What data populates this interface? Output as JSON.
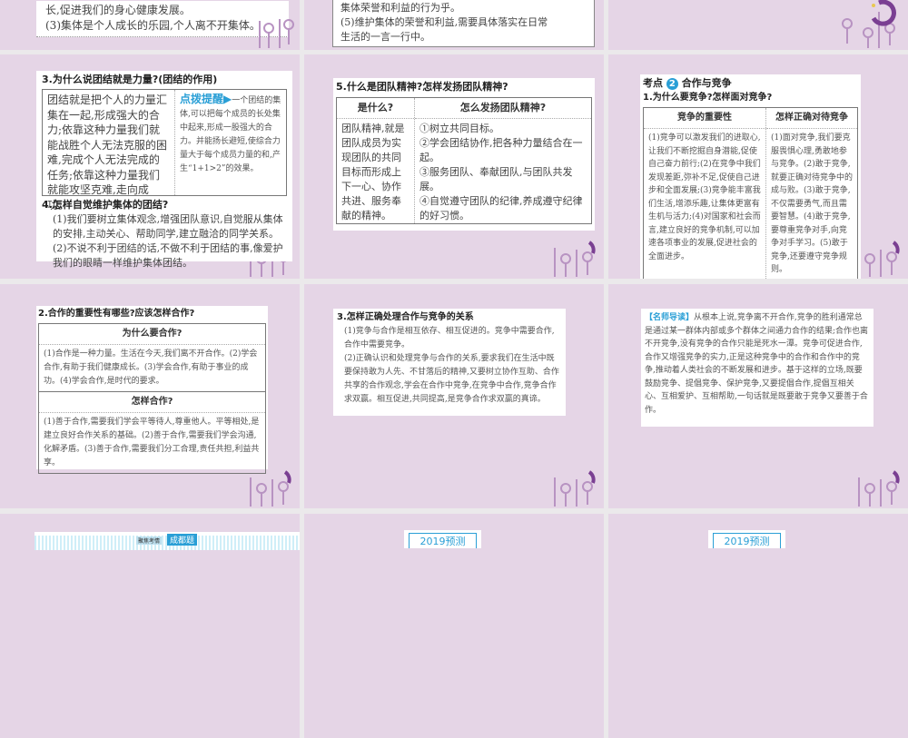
{
  "row1": {
    "s1_lines": [
      "长,促进我们的身心健康发展。",
      "(3)集体是个人成长的乐园,个人离不开集体。"
    ],
    "s2_lines": [
      "集体荣誉和利益的行为乎。",
      "(5)维护集体的荣誉和利益,需要具体落实在日常",
      "生活的一言一行中。"
    ]
  },
  "row2": {
    "s1": {
      "title": "3.为什么说团结就是力量?(团结的作用)",
      "left": "团结就是把个人的力量汇集在一起,形成强大的合力;依靠这种力量我们就能战胜个人无法克服的困难,完成个人无法完成的任务;依靠这种力量我们就能攻坚克难,走向成功。",
      "tip_label": "点拨提醒▶",
      "tip": "一个团结的集体,可以把每个成员的长处集中起来,形成一股强大的合力。并能扬长避短,使综合力量大于每个成员力量的和,产生“1+1>2”的效果。",
      "q4": "4.怎样自觉维护集体的团结?",
      "q4_1": "(1)我们要树立集体观念,增强团队意识,自觉服从集体的安排,主动关心、帮助同学,建立融洽的同学关系。",
      "q4_2": "(2)不说不利于团结的话,不做不利于团结的事,像爱护我们的眼睛一样维护集体团结。"
    },
    "s2": {
      "title": "5.什么是团队精神?怎样发扬团队精神?",
      "h1": "是什么?",
      "h2": "怎么发扬团队精神?",
      "left": "团队精神,就是团队成员为实现团队的共同目标而形成上下一心、协作共进、服务奉献的精神。",
      "items": [
        "①树立共同目标。",
        "②学会团结协作,把各种力量结合在一起。",
        "③服务团队、奉献团队,与团队共发展。",
        "④自觉遵守团队的纪律,养成遵守纪律的好习惯。"
      ]
    },
    "s3": {
      "kaodian": "考点",
      "num": "2",
      "topic": "合作与竞争",
      "title": "1.为什么要竞争?怎样面对竞争?",
      "h1": "竞争的重要性",
      "h2": "怎样正确对待竞争",
      "left": "(1)竞争可以激发我们的进取心,让我们不断挖掘自身潜能,促使自己奋力前行;(2)在竞争中我们发现差距,弥补不足,促使自己进步和全面发展;(3)竞争能丰富我们生活,增添乐趣,让集体更富有生机与活力;(4)对国家和社会而言,建立良好的竞争机制,可以加速各项事业的发展,促进社会的全面进步。",
      "right": "(1)面对竞争,我们要克服畏惧心理,勇敢地参与竞争。(2)敢于竞争,就要正确对待竞争中的成与败。(3)敢于竞争,不仅需要勇气,而且需要智慧。(4)敢于竞争,要尊重竞争对手,向竞争对手学习。(5)敢于竞争,还要遵守竞争规则。"
    }
  },
  "row3": {
    "s1": {
      "title": "2.合作的重要性有哪些?应该怎样合作?",
      "h1": "为什么要合作?",
      "b1": "(1)合作是一种力量。生活在今天,我们离不开合作。(2)学会合作,有助于我们健康成长。(3)学会合作,有助于事业的成功。(4)学会合作,是时代的要求。",
      "h2": "怎样合作?",
      "b2": "(1)善于合作,需要我们学会平等待人,尊重他人。平等相处,是建立良好合作关系的基础。(2)善于合作,需要我们学会沟通,化解矛盾。(3)善于合作,需要我们分工合理,责任共担,利益共享。"
    },
    "s2": {
      "title": "3.怎样正确处理合作与竞争的关系",
      "p1": "(1)竞争与合作是相互依存、相互促进的。竞争中需要合作,合作中需要竞争。",
      "p2": "(2)正确认识和处理竞争与合作的关系,要求我们在生活中既要保持敢为人先、不甘落后的精神,又要树立协作互助、合作共享的合作观念,学会在合作中竞争,在竞争中合作,竞争合作求双赢。相互促进,共同提高,是竞争合作求双赢的真谛。"
    },
    "s3": {
      "label": "【名师导读】",
      "text": "从根本上说,竞争离不开合作,竞争的胜利通常总是通过某一群体内部或多个群体之间通力合作的结果;合作也离不开竞争,没有竞争的合作只能是死水一潭。竞争可促进合作,合作又增强竞争的实力,正是这种竞争中的合作和合作中的竞争,推动着人类社会的不断发展和进步。基于这样的立场,既要鼓励竞争、提倡竞争、保护竞争,又要提倡合作,提倡互相关心、互相爱护、互相帮助,一句话就是既要敢于竞争又要善于合作。"
    }
  },
  "row4": {
    "s1_banner": "成都题",
    "s1_small": "聚焦考情",
    "s2_tag": "2019预测",
    "s3_tag": "2019预测"
  },
  "colors": {
    "slide_bg": "#e5d5e6",
    "gap": "#ebe9eb",
    "accent_blue": "#2a9fd6",
    "deco_purple": "#7a3f92"
  }
}
